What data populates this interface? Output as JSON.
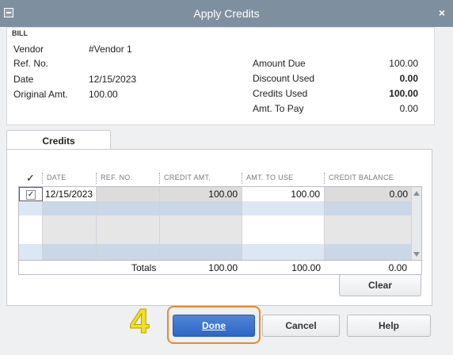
{
  "window": {
    "title": "Apply Credits",
    "close_glyph": "×"
  },
  "bill": {
    "section_label": "BILL",
    "vendor_label": "Vendor",
    "vendor_value": "#Vendor 1",
    "ref_label": "Ref. No.",
    "ref_value": "",
    "date_label": "Date",
    "date_value": "12/15/2023",
    "orig_label": "Original Amt.",
    "orig_value": "100.00",
    "amount_due_label": "Amount Due",
    "amount_due_value": "100.00",
    "discount_label": "Discount Used",
    "discount_value": "0.00",
    "credits_used_label": "Credits Used",
    "credits_used_value": "100.00",
    "amt_to_pay_label": "Amt. To Pay",
    "amt_to_pay_value": "0.00"
  },
  "tabs": [
    {
      "label": "Credits"
    }
  ],
  "table": {
    "check_header": "✓",
    "headers": [
      "DATE",
      "REF. NO.",
      "CREDIT AMT.",
      "AMT. TO USE",
      "CREDIT BALANCE"
    ],
    "rows": [
      {
        "checked": "✓",
        "date": "12/15/2023",
        "ref": "",
        "credit_amt": "100.00",
        "amt_to_use": "100.00",
        "credit_balance": "0.00"
      }
    ],
    "totals": {
      "label": "Totals",
      "credit_amt": "100.00",
      "amt_to_use": "100.00",
      "credit_balance": "0.00"
    }
  },
  "buttons": {
    "clear": "Clear",
    "done": "Done",
    "cancel": "Cancel",
    "help": "Help"
  },
  "annotation": {
    "step_number": "4"
  },
  "colors": {
    "titlebar": "#7e8fa0",
    "primary_button": "#2e66c4",
    "highlight": "#e58a2f",
    "step_number": "#f2e21b"
  },
  "icons": {
    "system_menu": "system-menu-icon",
    "close": "close-icon",
    "scroll_up": "scroll-up-icon",
    "scroll_down": "scroll-down-icon"
  }
}
